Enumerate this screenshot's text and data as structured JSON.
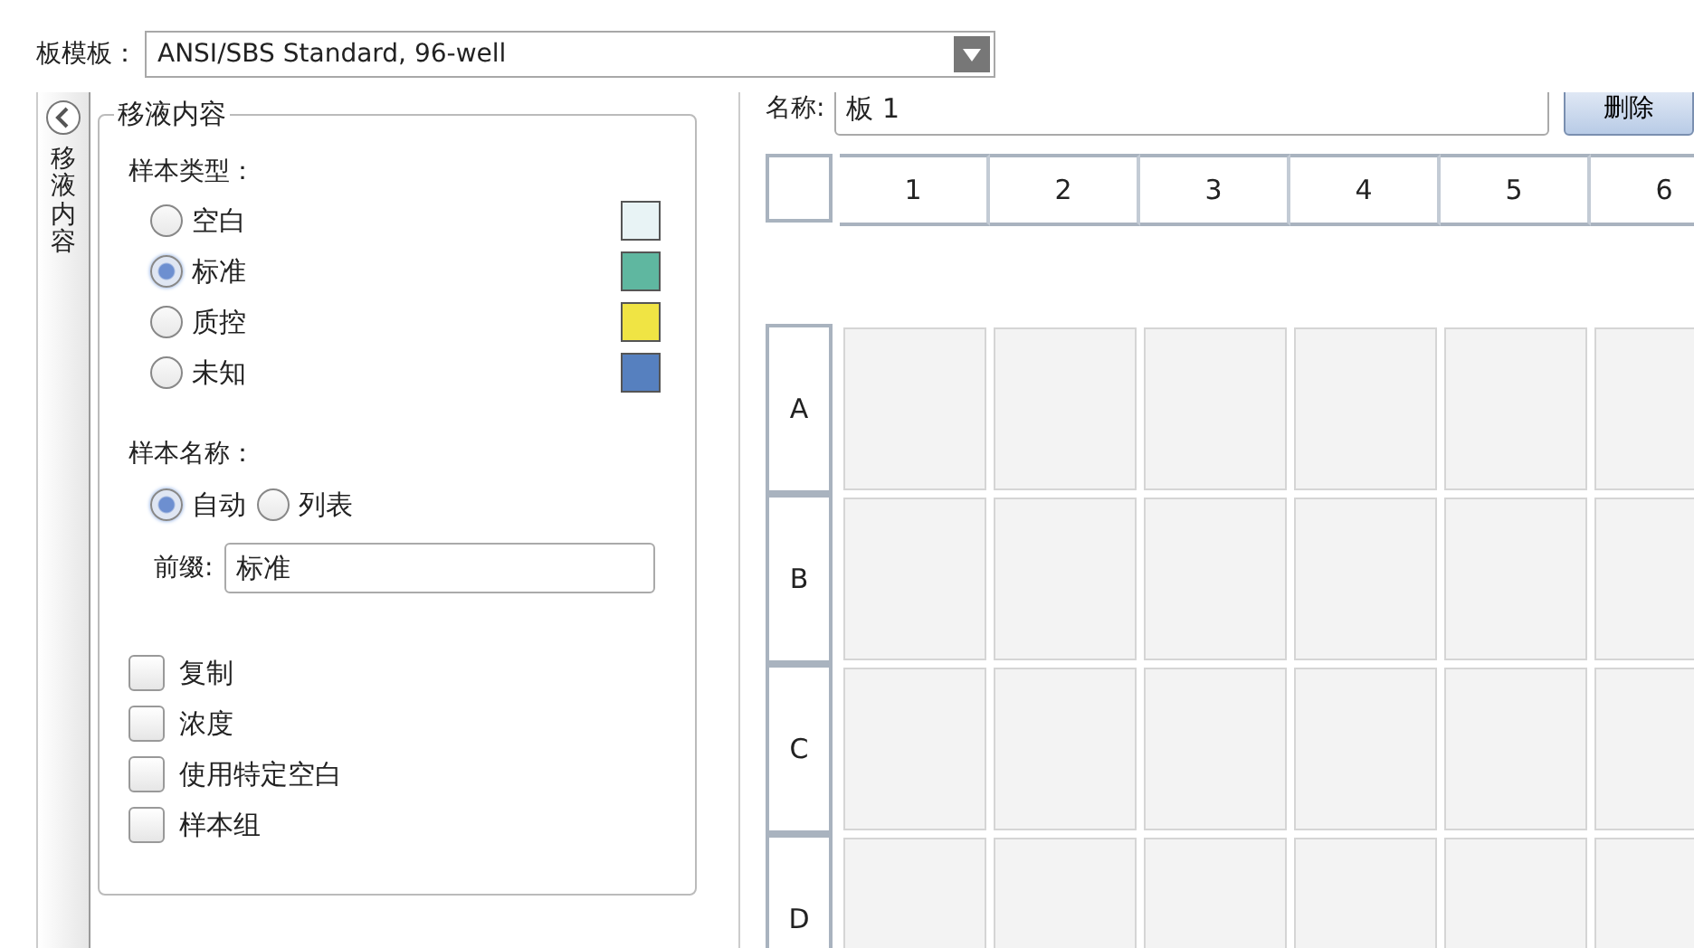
{
  "template": {
    "label": "板模板：",
    "value": "ANSI/SBS Standard, 96-well"
  },
  "side_tab": {
    "label": "移液内容"
  },
  "group": {
    "title": "移液内容",
    "sample_type_label": "样本类型：",
    "sample_types": [
      {
        "label": "空白",
        "selected": false,
        "color": "#e8f3f5"
      },
      {
        "label": "标准",
        "selected": true,
        "color": "#5fb7a0"
      },
      {
        "label": "质控",
        "selected": false,
        "color": "#f0e444"
      },
      {
        "label": "未知",
        "selected": false,
        "color": "#5680bf"
      }
    ],
    "sample_name_label": "样本名称：",
    "name_modes": [
      {
        "label": "自动",
        "selected": true
      },
      {
        "label": "列表",
        "selected": false
      }
    ],
    "prefix": {
      "label": "前缀:",
      "value": "标准"
    },
    "options": [
      {
        "label": "复制",
        "checked": false
      },
      {
        "label": "浓度",
        "checked": false
      },
      {
        "label": "使用特定空白",
        "checked": false
      },
      {
        "label": "样本组",
        "checked": false
      }
    ]
  },
  "plate": {
    "name_label": "名称:",
    "name_value": "板 1",
    "delete_button": "删除",
    "columns": [
      "1",
      "2",
      "3",
      "4",
      "5",
      "6"
    ],
    "rows": [
      "A",
      "B",
      "C",
      "D"
    ]
  }
}
